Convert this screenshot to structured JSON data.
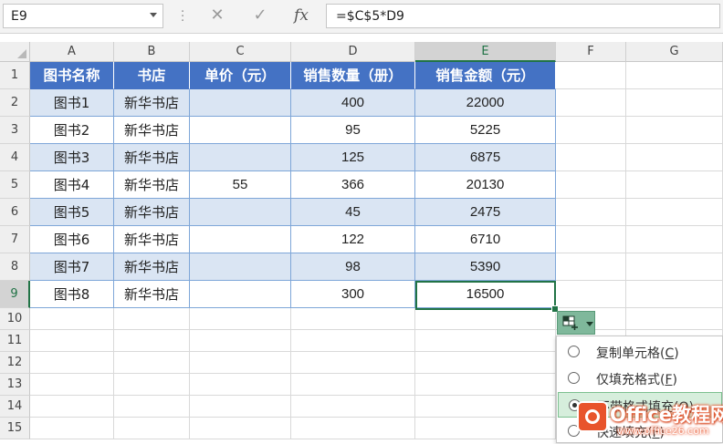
{
  "formula_bar": {
    "name_box": "E9",
    "cancel_glyph": "✕",
    "enter_glyph": "✓",
    "fx_glyph": "fx",
    "formula": "=$C$5*D9"
  },
  "columns": [
    "A",
    "B",
    "C",
    "D",
    "E",
    "F",
    "G"
  ],
  "selected_column": "E",
  "rows": [
    "1",
    "2",
    "3",
    "4",
    "5",
    "6",
    "7",
    "8",
    "9",
    "10",
    "11",
    "12",
    "13",
    "14",
    "15"
  ],
  "selected_row": "9",
  "table": {
    "headers": [
      "图书名称",
      "书店",
      "单价（元）",
      "销售数量（册）",
      "销售金额（元）"
    ],
    "rows": [
      [
        "图书1",
        "新华书店",
        "",
        "400",
        "22000"
      ],
      [
        "图书2",
        "新华书店",
        "",
        "95",
        "5225"
      ],
      [
        "图书3",
        "新华书店",
        "",
        "125",
        "6875"
      ],
      [
        "图书4",
        "新华书店",
        "55",
        "366",
        "20130"
      ],
      [
        "图书5",
        "新华书店",
        "",
        "45",
        "2475"
      ],
      [
        "图书6",
        "新华书店",
        "",
        "122",
        "6710"
      ],
      [
        "图书7",
        "新华书店",
        "",
        "98",
        "5390"
      ],
      [
        "图书8",
        "新华书店",
        "",
        "300",
        "16500"
      ]
    ]
  },
  "autofill_menu": {
    "button_icon": "autofill-options-icon",
    "items": [
      {
        "label": "复制单元格(",
        "key": "C",
        "close": ")",
        "selected": false
      },
      {
        "label": "仅填充格式(",
        "key": "F",
        "close": ")",
        "selected": false
      },
      {
        "label": "不带格式填充(",
        "key": "O",
        "close": ")",
        "selected": true
      },
      {
        "label": "快速填充(",
        "key": "F",
        "close": ")",
        "selected": false
      }
    ]
  },
  "watermark": {
    "title": "Office教程网",
    "url": "www.office26.com"
  },
  "colors": {
    "header_fill": "#4472c4",
    "band_fill": "#dae5f3",
    "selection": "#217346",
    "watermark": "#e8542c"
  }
}
